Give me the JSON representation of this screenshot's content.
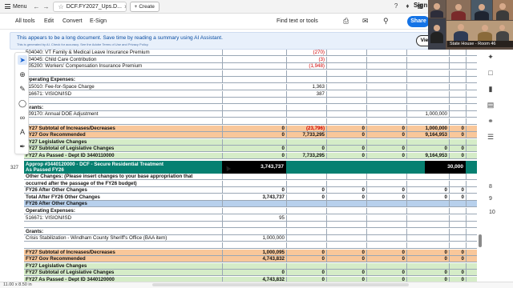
{
  "topbar": {
    "menu_label": "Menu",
    "tab_title": "DCF.FY2027_Ups.D...",
    "create_label": "Create",
    "sign_label": "Sign"
  },
  "toolbar": {
    "items": [
      "All tools",
      "Edit",
      "Convert",
      "E-Sign"
    ],
    "find_placeholder": "Find text or tools",
    "share_label": "Share"
  },
  "banner": {
    "message": "This appears to be a long document. Save time by reading a summary using AI Assistant.",
    "fineprint": "This is generated by AI. Check for accuracy. See the Adobe Terms of Use and Privacy Policy.",
    "view_label": "View"
  },
  "video": {
    "label": "State House - Room 46"
  },
  "right_panel": {
    "page_numbers": [
      "8",
      "9",
      "10"
    ]
  },
  "status": {
    "page_size": "11.00 x 8.50 in"
  },
  "table": {
    "rows": [
      {
        "label": "504040: VT Family & Medical Leave Insurance Premium",
        "cells": [
          "",
          "(270)",
          "",
          "",
          "",
          "",
          ""
        ],
        "neg": [
          1
        ],
        "style": "plain"
      },
      {
        "label": "504045: Child Care Contribution",
        "cells": [
          "",
          "(3)",
          "",
          "",
          "",
          "",
          ""
        ],
        "neg": [
          1
        ],
        "style": "plain"
      },
      {
        "label": "505200: Workers' Compensation Insurance Premium",
        "cells": [
          "",
          "(1,948)",
          "",
          "",
          "",
          "",
          ""
        ],
        "neg": [
          1
        ],
        "style": "plain"
      },
      {
        "label": "",
        "cells": [
          "",
          "",
          "",
          "",
          "",
          "",
          ""
        ],
        "style": "plain"
      },
      {
        "label": "Operating Expenses:",
        "cells": [
          "",
          "",
          "",
          "",
          "",
          "",
          ""
        ],
        "style": "bold"
      },
      {
        "label": "515010: Fee-for-Space Charge",
        "cells": [
          "",
          "1,363",
          "",
          "",
          "",
          "",
          ""
        ],
        "style": "plain"
      },
      {
        "label": "516671: VISION/ISD",
        "cells": [
          "",
          "387",
          "",
          "",
          "",
          "",
          ""
        ],
        "style": "plain"
      },
      {
        "label": "",
        "cells": [
          "",
          "",
          "",
          "",
          "",
          "",
          ""
        ],
        "style": "plain"
      },
      {
        "label": "Grants:",
        "cells": [
          "",
          "",
          "",
          "",
          "",
          "",
          ""
        ],
        "style": "bold"
      },
      {
        "label": "609170: Annual DOE Adjustment",
        "cells": [
          "",
          "",
          "",
          "",
          "1,000,000",
          "",
          ""
        ],
        "style": "plain"
      },
      {
        "label": "",
        "cells": [
          "",
          "",
          "",
          "",
          "",
          "",
          ""
        ],
        "style": "plain"
      },
      {
        "label": "FY27 Subtotal of Increases/Decreases",
        "cells": [
          "0",
          "(23,796)",
          "0",
          "0",
          "1,000,000",
          "0",
          "0"
        ],
        "neg": [
          1
        ],
        "style": "orange"
      },
      {
        "label": "FY27 Gov Recommended",
        "cells": [
          "0",
          "7,733,295",
          "0",
          "0",
          "9,164,953",
          "0",
          "0"
        ],
        "style": "orange"
      },
      {
        "label": "FY27 Legislative Changes",
        "cells": [
          "",
          "",
          "",
          "",
          "",
          "",
          ""
        ],
        "style": "green"
      },
      {
        "label": "FY27 Subtotal of Legislative Changes",
        "cells": [
          "0",
          "0",
          "0",
          "0",
          "0",
          "0",
          "0"
        ],
        "style": "green"
      },
      {
        "label": "FY27 As Passed - Dept ID 3440110000",
        "cells": [
          "0",
          "7,733,295",
          "0",
          "0",
          "9,164,953",
          "0",
          "0"
        ],
        "style": "green"
      }
    ],
    "approp": {
      "line_number": "327",
      "title": "Approp #3440120000 - DCF - Secure Residential Treatment",
      "subtitle": "As Passed FY26",
      "value1": "3,743,737",
      "value2": "30,000"
    },
    "rows2": [
      {
        "label": "Other Changes: (Please insert changes to your base appropriation that",
        "cells": [
          "",
          "",
          "",
          "",
          "",
          "",
          ""
        ],
        "style": "bold"
      },
      {
        "label": "occurred after the passage of the FY26 budget)",
        "cells": [
          "",
          "",
          "",
          "",
          "",
          "",
          ""
        ],
        "style": "bold"
      },
      {
        "label": "FY26 After Other Changes",
        "cells": [
          "0",
          "0",
          "0",
          "0",
          "0",
          "0",
          "0"
        ],
        "style": "bold"
      },
      {
        "label": "Total After FY26 Other Changes",
        "cells": [
          "3,743,737",
          "0",
          "0",
          "0",
          "0",
          "0",
          "30,000"
        ],
        "style": "bold"
      },
      {
        "label": "FY26 After Other Changes",
        "cells": [
          "",
          "",
          "",
          "",
          "",
          "",
          ""
        ],
        "style": "blue"
      },
      {
        "label": "Operating Expenses:",
        "cells": [
          "",
          "",
          "",
          "",
          "",
          "",
          ""
        ],
        "style": "bold"
      },
      {
        "label": "516671: VISION/ISD",
        "cells": [
          "95",
          "",
          "",
          "",
          "",
          "",
          ""
        ],
        "style": "plain"
      },
      {
        "label": "",
        "cells": [
          "",
          "",
          "",
          "",
          "",
          "",
          ""
        ],
        "style": "plain"
      },
      {
        "label": "Grants:",
        "cells": [
          "",
          "",
          "",
          "",
          "",
          "",
          ""
        ],
        "style": "bold"
      },
      {
        "label": "Crisis Stabilization - Windham County Sheriff's Office (BAA item)",
        "cells": [
          "1,000,000",
          "",
          "",
          "",
          "",
          "",
          ""
        ],
        "style": "plain"
      },
      {
        "label": "",
        "cells": [
          "",
          "",
          "",
          "",
          "",
          "",
          ""
        ],
        "style": "plain"
      },
      {
        "label": "FY27 Subtotal of Increases/Decreases",
        "cells": [
          "1,000,095",
          "0",
          "0",
          "0",
          "0",
          "0",
          "0"
        ],
        "style": "orange"
      },
      {
        "label": "FY27 Gov Recommended",
        "cells": [
          "4,743,832",
          "0",
          "0",
          "0",
          "0",
          "0",
          "30,000"
        ],
        "style": "orange"
      },
      {
        "label": "FY27 Legislative Changes",
        "cells": [
          "",
          "",
          "",
          "",
          "",
          "",
          ""
        ],
        "style": "green"
      },
      {
        "label": "FY27 Subtotal of Legislative Changes",
        "cells": [
          "0",
          "0",
          "0",
          "0",
          "0",
          "0",
          "0"
        ],
        "style": "green"
      },
      {
        "label": "FY27 As Passed - Dept ID 3440120000",
        "cells": [
          "4,743,832",
          "0",
          "0",
          "0",
          "0",
          "0",
          "30,000"
        ],
        "style": "green"
      }
    ]
  }
}
